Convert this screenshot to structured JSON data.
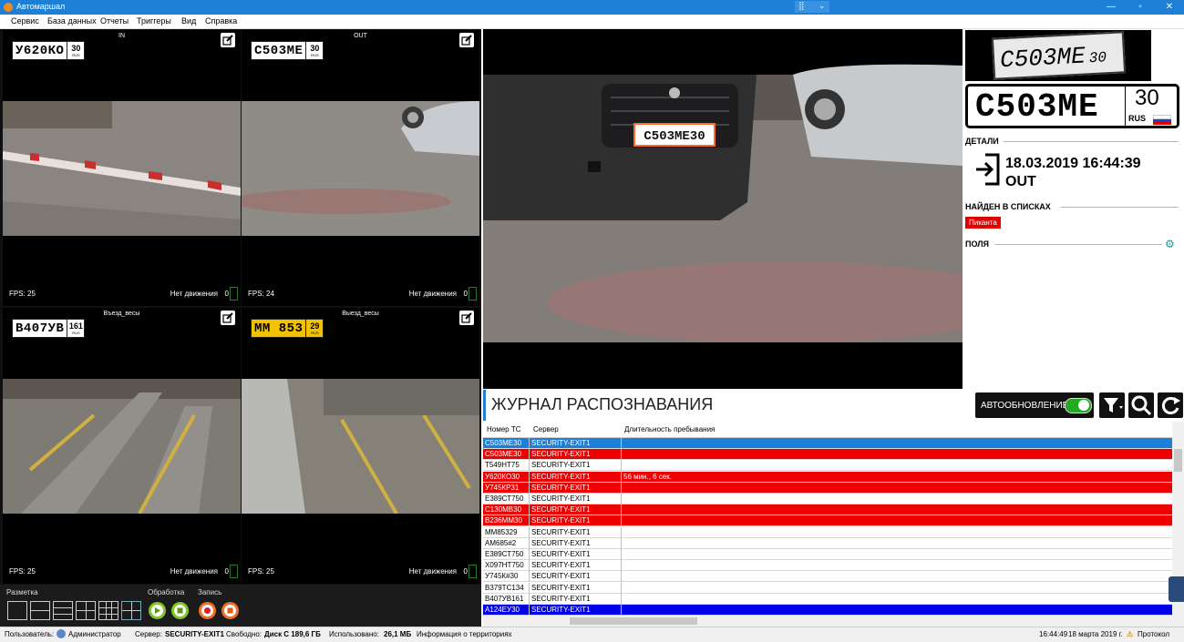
{
  "window": {
    "title": "Автомаршал",
    "center_control": "⣿ ⛶",
    "minimize": "—",
    "maximize": "▫",
    "close": "✕"
  },
  "menu": [
    "Сервис",
    "База данных",
    "Отчеты",
    "Триггеры",
    "Вид",
    "Справка"
  ],
  "cameras": [
    {
      "label": "IN",
      "plate": "У620КО",
      "region": "30",
      "country": "RUS",
      "fps": "FPS: 25",
      "motion": "Нет движения",
      "count": "0",
      "plate_style": "white"
    },
    {
      "label": "OUT",
      "plate": "С503МЕ",
      "region": "30",
      "country": "RUS",
      "fps": "FPS: 24",
      "motion": "Нет движения",
      "count": "0",
      "plate_style": "white"
    },
    {
      "label": "Въезд_весы",
      "plate": "В407УВ",
      "region": "161",
      "country": "RUS",
      "fps": "FPS: 25",
      "motion": "Нет движения",
      "count": "0",
      "plate_style": "white"
    },
    {
      "label": "Выезд_весы",
      "plate": "ММ 853",
      "region": "29",
      "country": "RUS",
      "fps": "FPS: 25",
      "motion": "Нет движения",
      "count": "0",
      "plate_style": "yellow"
    }
  ],
  "controls": {
    "layout_label": "Разметка",
    "processing_label": "Обработка",
    "record_label": "Запись"
  },
  "main_video": {
    "plate_overlay": "С503МЕ30"
  },
  "details": {
    "plate_photo_text": "С503МЕ",
    "plate_photo_region": "30",
    "plate_number": "С503МЕ",
    "plate_region": "30",
    "plate_country": "RUS",
    "section_details": "ДЕТАЛИ",
    "datetime": "18.03.2019 16:44:39",
    "direction": "OUT",
    "section_found": "НАЙДЕН В СПИСКАХ",
    "list_badge": "Пиканта",
    "section_fields": "ПОЛЯ"
  },
  "journal": {
    "title": "ЖУРНАЛ РАСПОЗНАВАНИЯ",
    "autoupdate_label": "АВТООБНОВЛЕНИЕ",
    "autoupdate_on": true,
    "columns": [
      "Номер ТС",
      "Сервер",
      "Длительность пребывания"
    ],
    "rows": [
      {
        "plate": "С503МЕ30",
        "server": "SECURITY-EXIT1",
        "duration": "",
        "state": "selected"
      },
      {
        "plate": "С503МЕ30",
        "server": "SECURITY-EXIT1",
        "duration": "",
        "state": "red"
      },
      {
        "plate": "Т549НТ75",
        "server": "SECURITY-EXIT1",
        "duration": "",
        "state": "normal"
      },
      {
        "plate": "У620КО30",
        "server": "SECURITY-EXIT1",
        "duration": "56 мин., 6 сек.",
        "state": "red"
      },
      {
        "plate": "У745КР31",
        "server": "SECURITY-EXIT1",
        "duration": "",
        "state": "red"
      },
      {
        "plate": "Е389СТ750",
        "server": "SECURITY-EXIT1",
        "duration": "",
        "state": "normal"
      },
      {
        "plate": "С130МВ30",
        "server": "SECURITY-EXIT1",
        "duration": "",
        "state": "red"
      },
      {
        "plate": "В236ММ30",
        "server": "SECURITY-EXIT1",
        "duration": "",
        "state": "red"
      },
      {
        "plate": "ММ85329",
        "server": "SECURITY-EXIT1",
        "duration": "",
        "state": "normal"
      },
      {
        "plate": "АМ685#2",
        "server": "SECURITY-EXIT1",
        "duration": "",
        "state": "normal"
      },
      {
        "plate": "Е389СТ750",
        "server": "SECURITY-EXIT1",
        "duration": "",
        "state": "normal"
      },
      {
        "plate": "Х097НТ750",
        "server": "SECURITY-EXIT1",
        "duration": "",
        "state": "normal"
      },
      {
        "plate": "У745К#30",
        "server": "SECURITY-EXIT1",
        "duration": "",
        "state": "normal"
      },
      {
        "plate": "В379ТС134",
        "server": "SECURITY-EXIT1",
        "duration": "",
        "state": "normal"
      },
      {
        "plate": "В407УВ161",
        "server": "SECURITY-EXIT1",
        "duration": "",
        "state": "normal"
      },
      {
        "plate": "А124ЕУ30",
        "server": "SECURITY-EXIT1",
        "duration": "",
        "state": "blue"
      }
    ]
  },
  "status": {
    "users_label": "Пользователь:",
    "user": "Администратор",
    "server_label": "Сервер:",
    "server": "SECURITY-EXIT1",
    "free_label": "Свободно:",
    "free_value": "Диск С  189,6 ГБ",
    "used_label": "Использовано:",
    "used_value": "26,1 МБ",
    "territory": "Информация о территориях",
    "time": "16:44:49",
    "date": "18 марта 2019 г.",
    "protocol": "Протокол"
  },
  "colors": {
    "accent": "#1e7fd6",
    "row_red": "#ee0000",
    "row_blue": "#0000e6",
    "row_selected": "#1e7fd6",
    "badge_red": "#e00000",
    "toggle_green": "#22aa22"
  }
}
